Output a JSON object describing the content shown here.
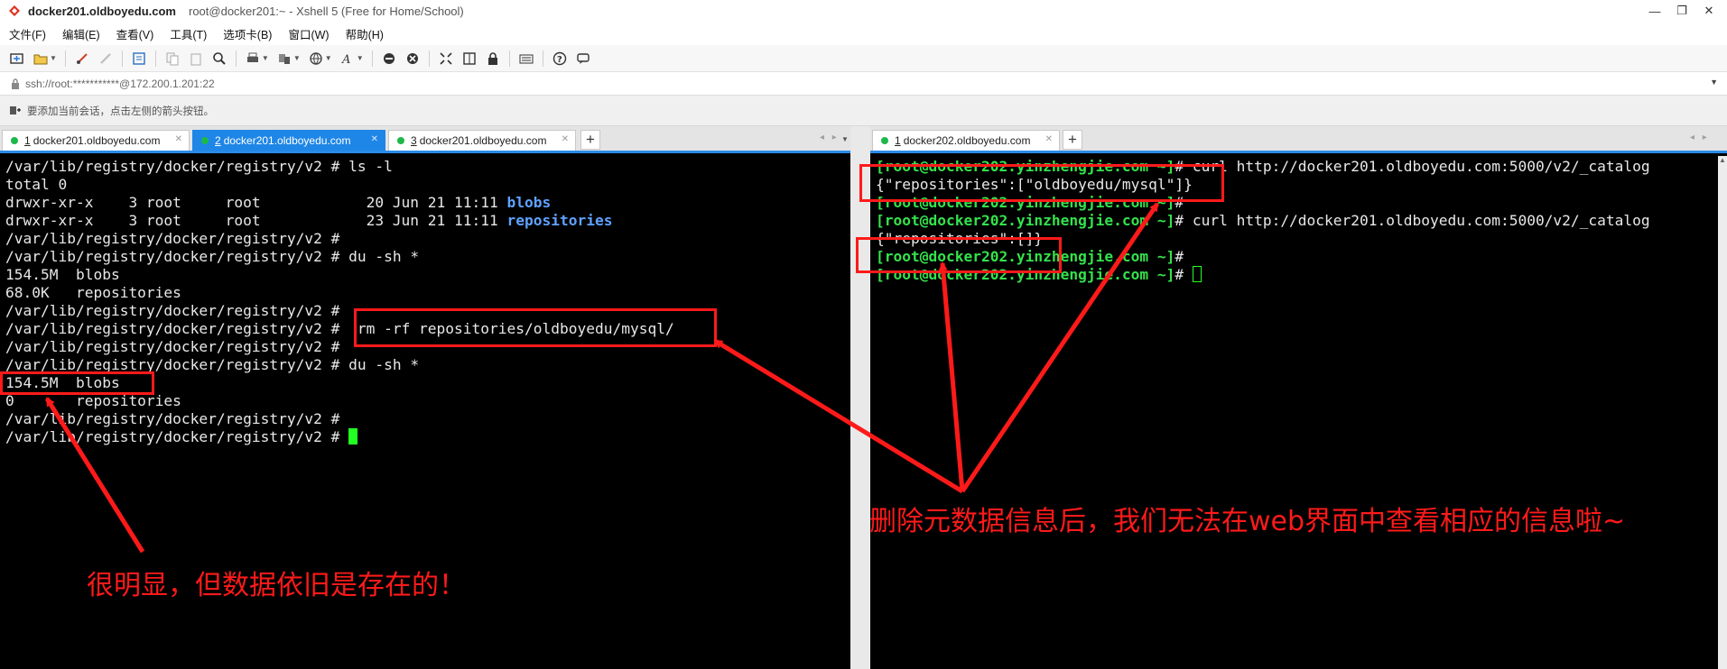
{
  "window": {
    "title_strong": "docker201.oldboyedu.com",
    "title_rest": "root@docker201:~ - Xshell 5 (Free for Home/School)",
    "controls": [
      "—",
      "❐",
      "✕"
    ]
  },
  "menu": [
    "文件(F)",
    "编辑(E)",
    "查看(V)",
    "工具(T)",
    "选项卡(B)",
    "窗口(W)",
    "帮助(H)"
  ],
  "address": "ssh://root:***********@172.200.1.201:22",
  "hint": "要添加当前会话，点击左侧的箭头按钮。",
  "left_tabs": [
    {
      "num": "1",
      "label": "docker201.oldboyedu.com"
    },
    {
      "num": "2",
      "label": "docker201.oldboyedu.com"
    },
    {
      "num": "3",
      "label": "docker201.oldboyedu.com"
    }
  ],
  "right_tabs": [
    {
      "num": "1",
      "label": "docker202.oldboyedu.com"
    }
  ],
  "left_terminal": {
    "prompt": "/var/lib/registry/docker/registry/v2 # ",
    "cmd_ls": "ls -l",
    "total": "total 0",
    "ls_blobs_meta": "drwxr-xr-x    3 root     root            20 Jun 21 11:11 ",
    "ls_blobs_name": "blobs",
    "ls_repos_meta": "drwxr-xr-x    3 root     root            23 Jun 21 11:11 ",
    "ls_repos_name": "repositories",
    "cmd_du": "du -sh *",
    "du1_blobs": "154.5M  blobs",
    "du1_repos": "68.0K   repositories",
    "cmd_rm": " rm -rf repositories/oldboyedu/mysql/",
    "du2_blobs": "154.5M  blobs",
    "du2_repos": "0       repositories"
  },
  "right_terminal": {
    "prompt_user": "[root@docker202.yinzhengjie.com ~]",
    "prompt_hash": "# ",
    "curl_cmd": "curl http://docker201.oldboyedu.com:5000/v2/_catalog",
    "out1": "{\"repositories\":[\"oldboyedu/mysql\"]}",
    "out2": "{\"repositories\":[]}"
  },
  "annotations": {
    "left_text": "很明显，但数据依旧是存在的！",
    "right_text": "删除元数据信息后，我们无法在web界面中查看相应的信息啦~",
    "color": "#ff1a1a"
  },
  "colors": {
    "tab_active": "#1e86e6",
    "dir_blue": "#5fa2ff",
    "prompt_green": "#34e24b",
    "cursor": "#22ff22"
  }
}
